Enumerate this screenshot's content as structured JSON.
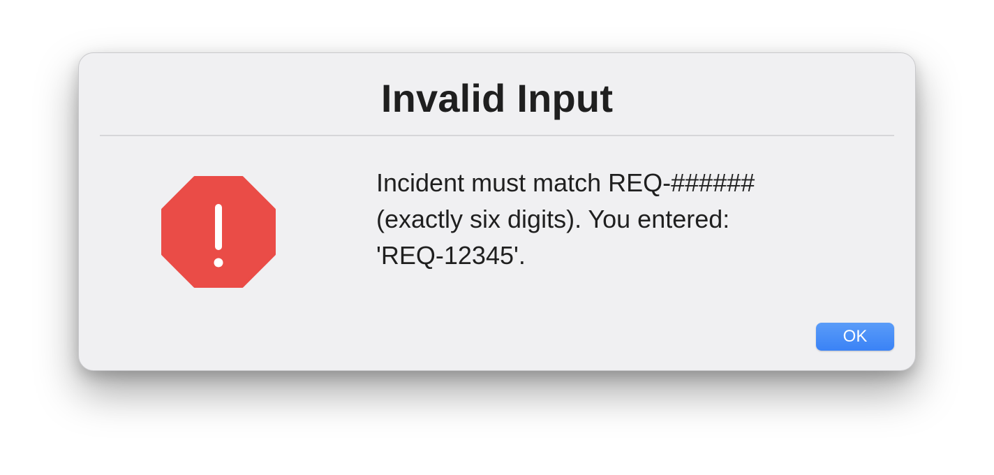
{
  "dialog": {
    "title": "Invalid Input",
    "icon": "stop-alert-icon",
    "icon_color": "#ea4c47",
    "message_lines": [
      "Incident must match REQ-######",
      "(exactly six digits). You entered:",
      "'REQ-12345'."
    ],
    "ok_label": "OK",
    "accent_color": "#3a82f6"
  }
}
